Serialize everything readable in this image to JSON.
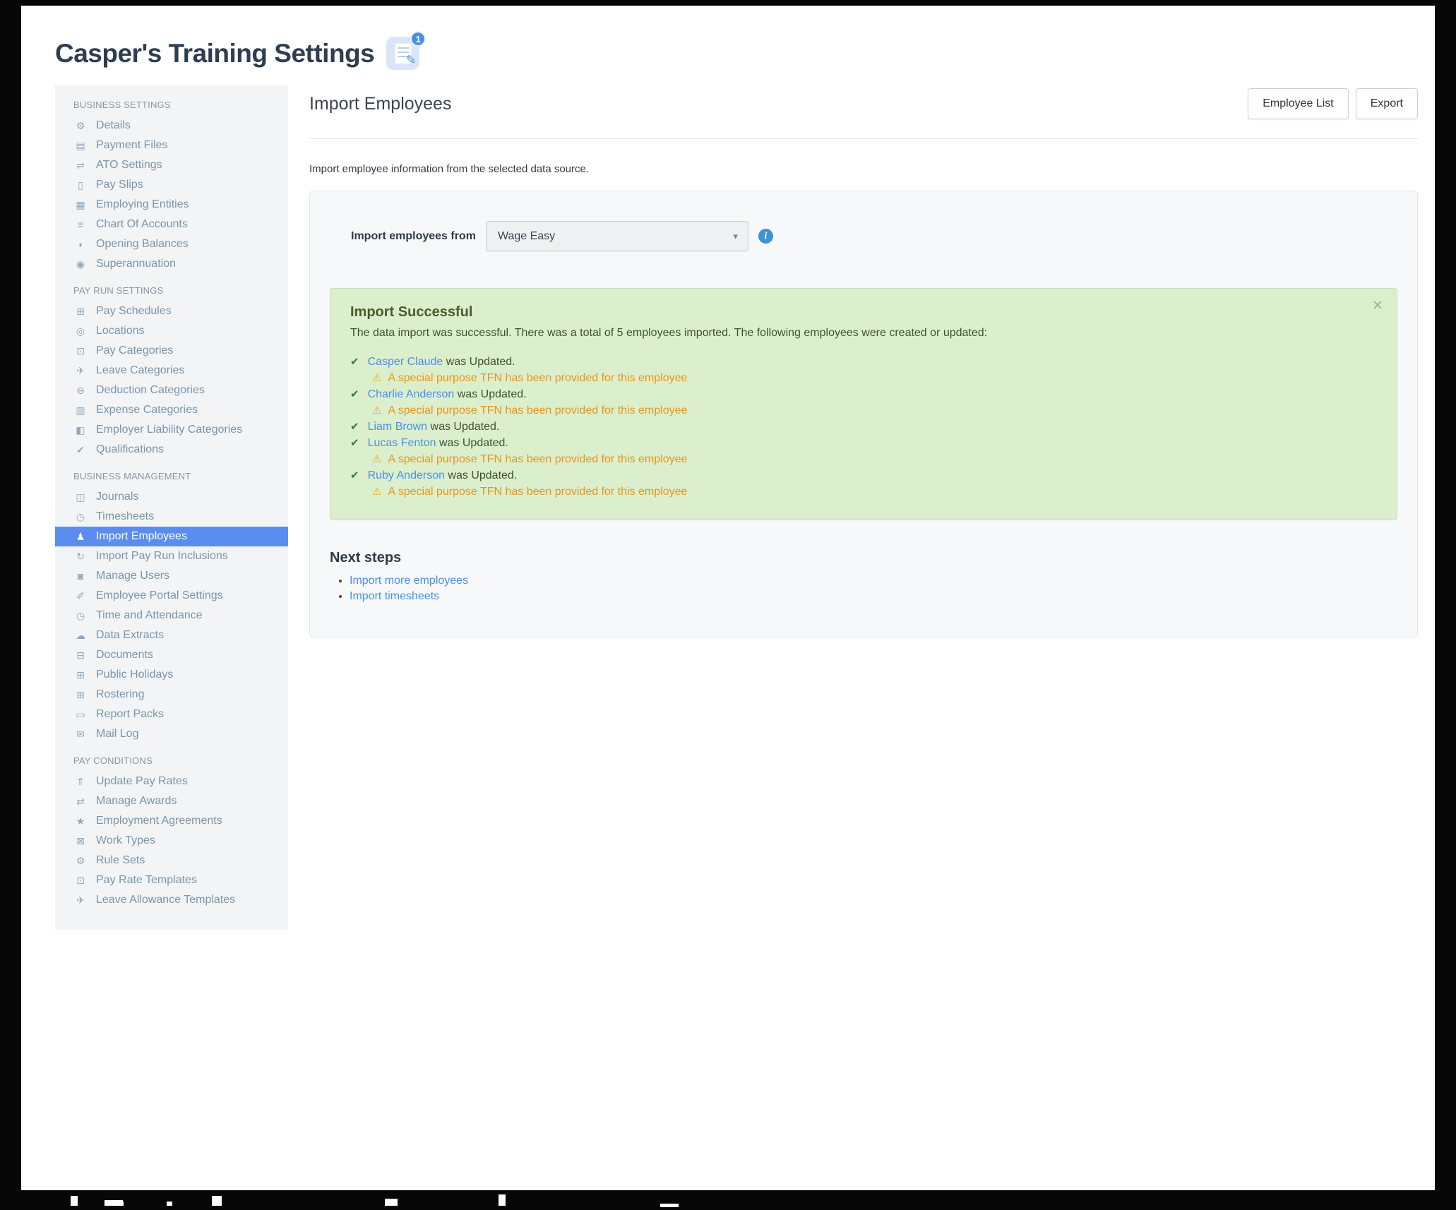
{
  "app": {
    "title": "Casper's Training Settings",
    "notifications_badge": "1"
  },
  "sidebar": {
    "sections": [
      {
        "label": "BUSINESS SETTINGS",
        "items": [
          {
            "label": "Details",
            "icon": "gear"
          },
          {
            "label": "Payment Files",
            "icon": "save"
          },
          {
            "label": "ATO Settings",
            "icon": "scales"
          },
          {
            "label": "Pay Slips",
            "icon": "file"
          },
          {
            "label": "Employing Entities",
            "icon": "bank"
          },
          {
            "label": "Chart Of Accounts",
            "icon": "list"
          },
          {
            "label": "Opening Balances",
            "icon": "leaf"
          },
          {
            "label": "Superannuation",
            "icon": "globe"
          }
        ]
      },
      {
        "label": "PAY RUN SETTINGS",
        "items": [
          {
            "label": "Pay Schedules",
            "icon": "calendar"
          },
          {
            "label": "Locations",
            "icon": "marker"
          },
          {
            "label": "Pay Categories",
            "icon": "money-card"
          },
          {
            "label": "Leave Categories",
            "icon": "plane"
          },
          {
            "label": "Deduction Categories",
            "icon": "minus-circle"
          },
          {
            "label": "Expense Categories",
            "icon": "grid"
          },
          {
            "label": "Employer Liability Categories",
            "icon": "bar-chart"
          },
          {
            "label": "Qualifications",
            "icon": "check"
          }
        ]
      },
      {
        "label": "BUSINESS MANAGEMENT",
        "items": [
          {
            "label": "Journals",
            "icon": "book"
          },
          {
            "label": "Timesheets",
            "icon": "clock"
          },
          {
            "label": "Import Employees",
            "icon": "people",
            "active": true
          },
          {
            "label": "Import Pay Run Inclusions",
            "icon": "sync"
          },
          {
            "label": "Manage Users",
            "icon": "lock"
          },
          {
            "label": "Employee Portal Settings",
            "icon": "wand"
          },
          {
            "label": "Time and Attendance",
            "icon": "clock"
          },
          {
            "label": "Data Extracts",
            "icon": "cloud-download"
          },
          {
            "label": "Documents",
            "icon": "folder"
          },
          {
            "label": "Public Holidays",
            "icon": "calendar"
          },
          {
            "label": "Rostering",
            "icon": "calendar"
          },
          {
            "label": "Report Packs",
            "icon": "folder-open"
          },
          {
            "label": "Mail Log",
            "icon": "envelope"
          }
        ]
      },
      {
        "label": "PAY CONDITIONS",
        "items": [
          {
            "label": "Update Pay Rates",
            "icon": "money-up"
          },
          {
            "label": "Manage Awards",
            "icon": "transfer"
          },
          {
            "label": "Employment Agreements",
            "icon": "star"
          },
          {
            "label": "Work Types",
            "icon": "briefcase"
          },
          {
            "label": "Rule Sets",
            "icon": "wrench"
          },
          {
            "label": "Pay Rate Templates",
            "icon": "money-card"
          },
          {
            "label": "Leave Allowance Templates",
            "icon": "plane"
          }
        ]
      }
    ]
  },
  "main": {
    "title": "Import Employees",
    "buttons": {
      "employee_list": "Employee List",
      "export": "Export"
    },
    "description": "Import employee information from the selected data source.",
    "import_form": {
      "label": "Import employees from",
      "selected_source": "Wage Easy"
    },
    "alert": {
      "title": "Import Successful",
      "close": "×",
      "message": "The data import was successful. There was a total of 5 employees imported. The following employees were created or updated:",
      "warning_text": "A special purpose TFN has been provided for this employee",
      "employees": [
        {
          "name": "Casper Claude",
          "suffix": "was Updated.",
          "tfn_warning": true
        },
        {
          "name": "Charlie Anderson",
          "suffix": "was Updated.",
          "tfn_warning": true
        },
        {
          "name": "Liam Brown",
          "suffix": "was Updated.",
          "tfn_warning": false
        },
        {
          "name": "Lucas Fenton",
          "suffix": "was Updated.",
          "tfn_warning": true
        },
        {
          "name": "Ruby Anderson",
          "suffix": "was Updated.",
          "tfn_warning": true
        }
      ]
    },
    "next_steps": {
      "title": "Next steps",
      "links": [
        "Import more employees",
        "Import timesheets"
      ]
    }
  },
  "colors": {
    "accent_blue": "#5a8def",
    "link_blue": "#4a90e2",
    "success_green_bg": "#dcefcd",
    "warning_orange": "#e8991f",
    "sidebar_text": "#7b95aa"
  }
}
